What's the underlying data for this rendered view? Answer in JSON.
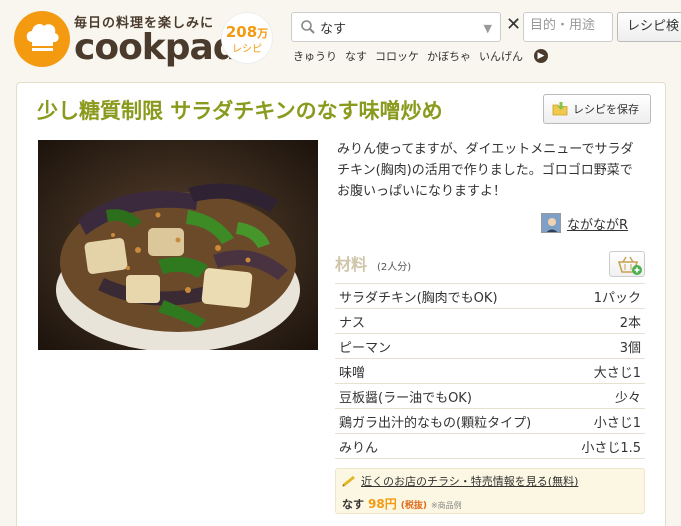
{
  "header": {
    "tagline": "毎日の料理を楽しみに",
    "wordmark": "cookpad",
    "recipe_count_number": "208",
    "recipe_count_suffix": "万",
    "recipe_count_unit": "レシピ"
  },
  "search": {
    "query": "なす",
    "purpose_placeholder": "目的・用途",
    "button_label": "レシピ検"
  },
  "keywords": [
    "きゅうり",
    "なす",
    "コロッケ",
    "かぼちゃ",
    "いんげん"
  ],
  "recipe": {
    "title": "少し糖質制限 サラダチキンのなす味噌炒め",
    "save_label": "レシピを保存",
    "description": "みりん使ってますが、ダイエットメニューでサラダチキン(胸肉)の活用で作りました。ゴロゴロ野菜でお腹いっぱいになりますよ！",
    "author": "ながながR"
  },
  "ingredients": {
    "title": "材料",
    "servings": "(2人分)",
    "items": [
      {
        "name": "サラダチキン(胸肉でもOK)",
        "qty": "1パック"
      },
      {
        "name": "ナス",
        "qty": "2本"
      },
      {
        "name": "ピーマン",
        "qty": "3個"
      },
      {
        "name": "味噌",
        "qty": "大さじ1"
      },
      {
        "name": "豆板醤(ラー油でもOK)",
        "qty": "少々"
      },
      {
        "name": "鶏ガラ出汁的なもの(顆粒タイプ)",
        "qty": "小さじ1"
      },
      {
        "name": "みりん",
        "qty": "小さじ1.5"
      }
    ]
  },
  "promo": {
    "link_text": "近くのお店のチラシ・特売情報を見る(無料)",
    "item": "なす",
    "price": "98円",
    "tax": "(税抜)",
    "note": "※商品例"
  },
  "colors": {
    "brand_orange": "#f39a11",
    "title_green": "#8a9a1d",
    "brand_brown": "#4a3b2d"
  }
}
